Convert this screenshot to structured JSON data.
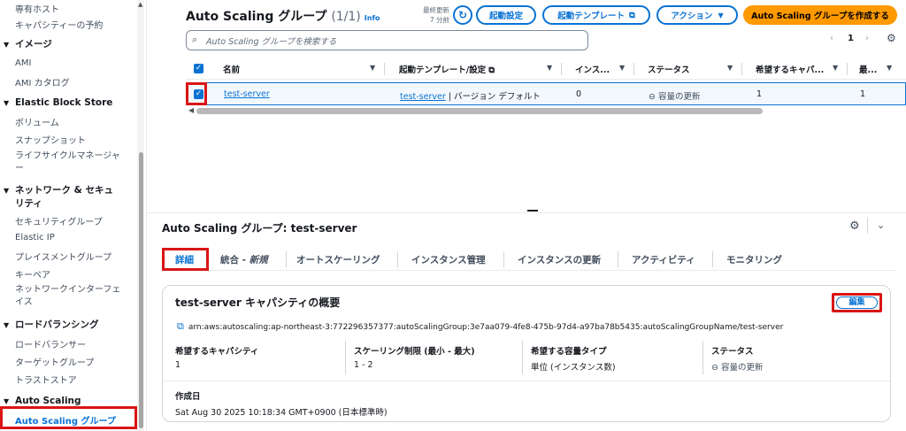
{
  "sidebar": {
    "items_top": [
      "専有ホスト",
      "キャパシティーの予約"
    ],
    "sections": [
      {
        "title": "イメージ",
        "items": [
          "AMI",
          "AMI カタログ"
        ]
      },
      {
        "title": "Elastic Block Store",
        "items": [
          "ボリューム",
          "スナップショット",
          "ライフサイクルマネージャー"
        ]
      },
      {
        "title_lines": [
          "ネットワーク & セキュ",
          "リティ"
        ],
        "items": [
          "セキュリティグループ",
          "Elastic IP",
          "プレイスメントグループ",
          "キーペア",
          "ネットワークインターフェイス"
        ]
      },
      {
        "title": "ロードバランシング",
        "items": [
          "ロードバランサー",
          "ターゲットグループ",
          "トラストストア"
        ]
      },
      {
        "title": "Auto Scaling",
        "items": [
          "Auto Scaling グループ"
        ]
      }
    ],
    "lcm_lines": [
      "ライフサイクルマネージャ",
      "ー"
    ],
    "ni_lines": [
      "ネットワークインターフェ",
      "イス"
    ]
  },
  "top": {
    "title": "Auto Scaling グループ",
    "count": "(1/1)",
    "info": "Info",
    "last_updated_lines": [
      "最終更新",
      "7 分前"
    ],
    "buttons": {
      "launch_config": "起動設定",
      "launch_template": "起動テンプレート",
      "actions": "アクション",
      "create": "Auto Scaling グループを作成する"
    },
    "search_placeholder": "Auto Scaling グループを検索する",
    "page": "1",
    "columns": [
      "名前",
      "起動テンプレート/設定",
      "インス...",
      "ステータス",
      "希望するキャパ...",
      "最..."
    ],
    "row": {
      "name": "test-server",
      "template_link": "test-server",
      "template_rest": " | バージョン デフォルト",
      "instances": "0",
      "status": "容量の更新",
      "desired": "1",
      "min": "1"
    }
  },
  "detail": {
    "title": "Auto Scaling グループ: test-server",
    "tabs": [
      "詳細",
      "統合 - 新規",
      "オートスケーリング",
      "インスタンス管理",
      "インスタンスの更新",
      "アクティビティ",
      "モニタリング"
    ],
    "tab_integration_main": "統合 - ",
    "tab_integration_new": "新規",
    "card_title": "test-server キャパシティの概要",
    "edit": "編集",
    "arn": "arn:aws:autoscaling:ap-northeast-3:772296357377:autoScalingGroup:3e7aa079-4fe8-475b-97d4-a97ba78b5435:autoScalingGroupName/test-server",
    "fields": [
      {
        "label": "希望するキャパシティ",
        "value": "1"
      },
      {
        "label": "スケーリング制限 (最小 - 最大)",
        "value": "1 - 2"
      },
      {
        "label": "希望する容量タイプ",
        "value": "単位 (インスタンス数)"
      },
      {
        "label": "ステータス",
        "value": "容量の更新"
      }
    ],
    "created_label": "作成日",
    "created_value": "Sat Aug 30 2025 10:18:34 GMT+0900 (日本標準時)"
  },
  "icons": {
    "refresh": "refresh-icon",
    "external": "external-link-icon",
    "settings": "gear-icon"
  },
  "colors": {
    "accent": "#0972d3",
    "primary": "#ff9900",
    "highlight": "#d91515"
  }
}
